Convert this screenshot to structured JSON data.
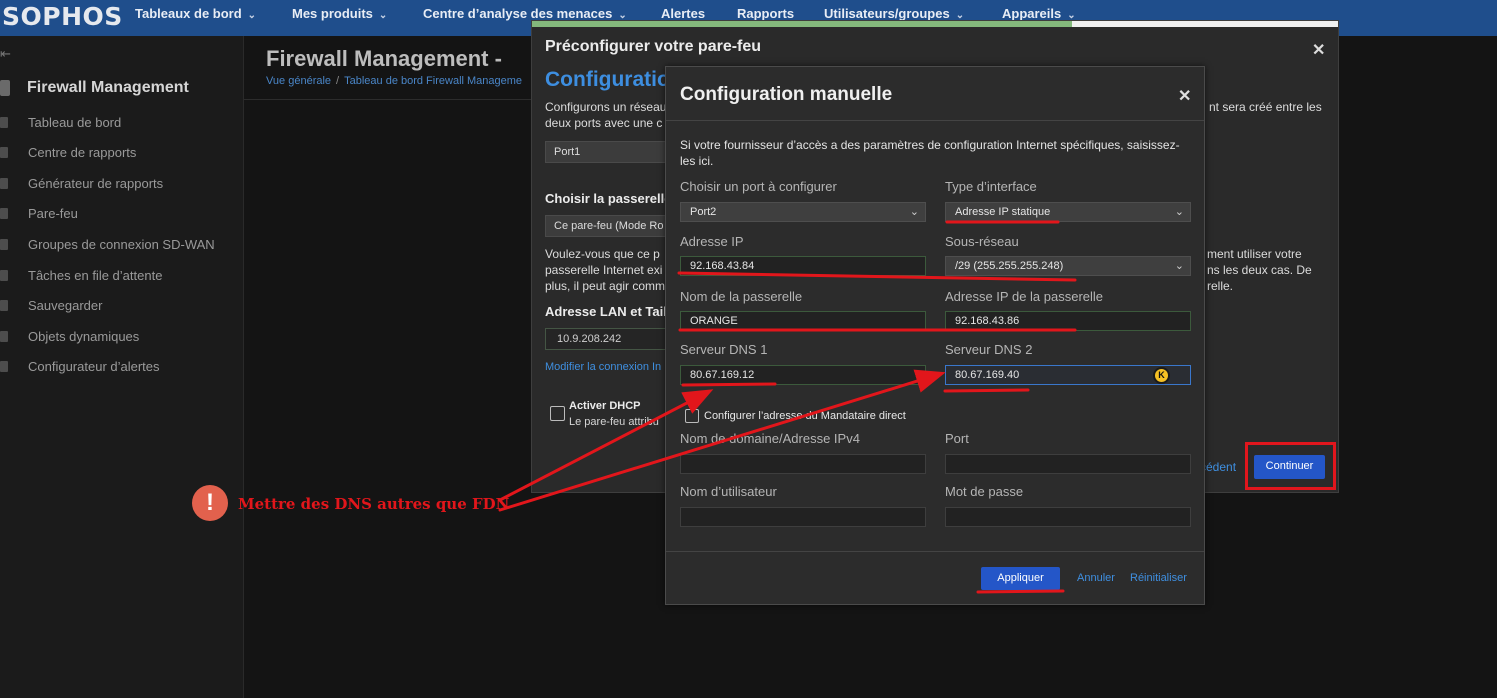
{
  "topnav": {
    "logo": "SOPHOS",
    "items": [
      {
        "label": "Tableaux de bord",
        "has_menu": true
      },
      {
        "label": "Mes produits",
        "has_menu": true
      },
      {
        "label": "Centre d’analyse des menaces",
        "has_menu": true
      },
      {
        "label": "Alertes",
        "has_menu": false
      },
      {
        "label": "Rapports",
        "has_menu": false
      },
      {
        "label": "Utilisateurs/groupes",
        "has_menu": true
      },
      {
        "label": "Appareils",
        "has_menu": true
      }
    ]
  },
  "sidebar": {
    "title": "Firewall Management",
    "items": [
      {
        "label": "Tableau de bord",
        "icon": "bar-chart-icon"
      },
      {
        "label": "Centre de rapports",
        "icon": "grid-icon"
      },
      {
        "label": "Générateur de rapports",
        "icon": "document-icon"
      },
      {
        "label": "Pare-feu",
        "icon": "flame-icon"
      },
      {
        "label": "Groupes de connexion SD-WAN",
        "icon": "network-icon"
      },
      {
        "label": "Tâches en file d’attente",
        "icon": "clock-icon"
      },
      {
        "label": "Sauvegarder",
        "icon": "cloud-icon"
      },
      {
        "label": "Objets dynamiques",
        "icon": "tag-icon"
      },
      {
        "label": "Configurateur d’alertes",
        "icon": "warning-icon"
      }
    ]
  },
  "page": {
    "title": "Firewall Management -",
    "breadcrumb": [
      "Vue générale",
      "Tableau de bord Firewall Manageme"
    ]
  },
  "outer_modal": {
    "title": "Préconfigurer votre pare-feu",
    "heading": "Configuratio",
    "intro_line1": "Configurons un réseau",
    "intro_line2": "deux ports avec une c",
    "intro_right": "nt sera créé entre les",
    "port_select": "Port1",
    "gateway_heading": "Choisir la passerelle",
    "gateway_select": "Ce pare-feu (Mode Ro",
    "question_line1": "Voulez-vous que ce p",
    "question_line2": "passerelle Internet exi",
    "question_line3": "plus, il peut agir comm",
    "question_right1": "ment utiliser votre",
    "question_right2": "ns les deux cas. De",
    "question_right3": "relle.",
    "lan_heading": "Adresse LAN et Taill",
    "lan_value": "10.9.208.242",
    "modify_link": "Modifier la connexion In",
    "dhcp_label": "Activer DHCP",
    "dhcp_sub": "Le pare-feu attribu",
    "back_link": "cédent",
    "continue_label": "Continuer",
    "progress_fraction": 0.67
  },
  "inner_modal": {
    "title": "Configuration manuelle",
    "description": "Si votre fournisseur d’accès a des paramètres de configuration Internet spécifiques, saisissez-les ici.",
    "fields": {
      "port": {
        "label": "Choisir un port à configurer",
        "value": "Port2"
      },
      "interface_type": {
        "label": "Type d’interface",
        "value": "Adresse IP statique"
      },
      "ip": {
        "label": "Adresse IP",
        "value": "92.168.43.84"
      },
      "subnet": {
        "label": "Sous-réseau",
        "value": "/29 (255.255.255.248)"
      },
      "gateway_name": {
        "label": "Nom de la passerelle",
        "value": "ORANGE"
      },
      "gateway_ip": {
        "label": "Adresse IP de la passerelle",
        "value": "92.168.43.86"
      },
      "dns1": {
        "label": "Serveur DNS 1",
        "value": "80.67.169.12"
      },
      "dns2": {
        "label": "Serveur DNS 2",
        "value": "80.67.169.40"
      },
      "proxy_checkbox": "Configurer l’adresse du Mandataire direct",
      "domain": {
        "label": "Nom de domaine/Adresse IPv4",
        "value": ""
      },
      "proxy_port": {
        "label": "Port",
        "value": ""
      },
      "username": {
        "label": "Nom d’utilisateur",
        "value": ""
      },
      "password": {
        "label": "Mot de passe",
        "value": ""
      }
    },
    "apply_label": "Appliquer",
    "cancel_label": "Annuler",
    "reset_label": "Réinitialiser"
  },
  "annotation": {
    "icon": "exclamation-icon",
    "text": "Mettre des DNS autres que FDN",
    "color": "#e2161b"
  },
  "colors": {
    "nav_bg": "#1f4e8c",
    "primary_button": "#2456c8",
    "link": "#3f8fe0",
    "annotation_red": "#e2161b"
  }
}
